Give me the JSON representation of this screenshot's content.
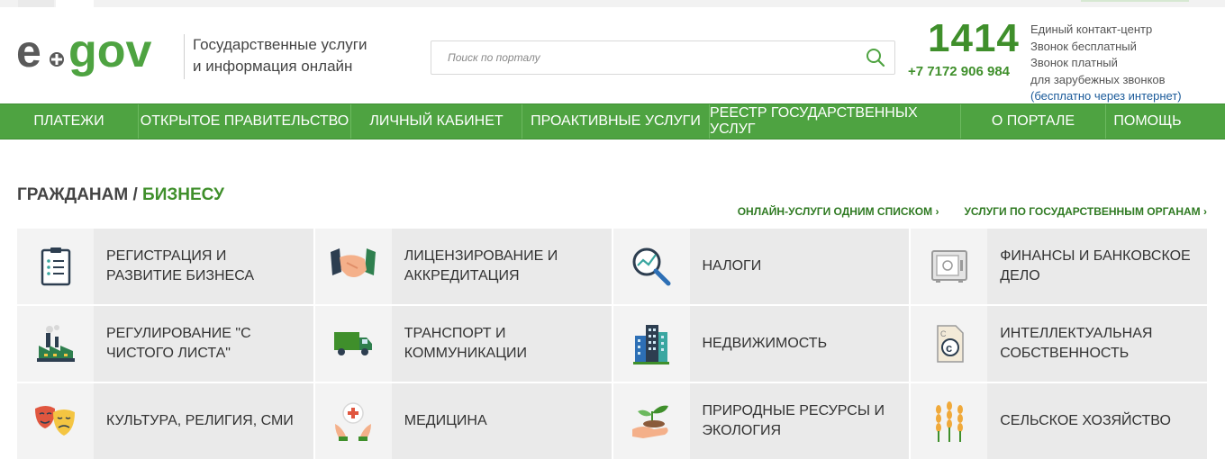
{
  "header": {
    "logo_text": "e.gov",
    "tagline_line1": "Государственные услуги",
    "tagline_line2": "и информация онлайн",
    "search_placeholder": "Поиск по порталу",
    "contact_number": "1414",
    "contact_phone": "+7 7172 906 984",
    "contact_line1": "Единый контакт-центр",
    "contact_line2": "Звонок бесплатный",
    "contact_line3": "Звонок платный",
    "contact_line4": "для зарубежных звонков",
    "contact_line5": "(бесплатно через интернет)"
  },
  "nav": [
    {
      "label": "ПЛАТЕЖИ",
      "width": 154
    },
    {
      "label": "ОТКРЫТОЕ ПРАВИТЕЛЬСТВО",
      "width": 236
    },
    {
      "label": "ЛИЧНЫЙ КАБИНЕТ",
      "width": 190
    },
    {
      "label": "ПРОАКТИВНЫЕ УСЛУГИ",
      "width": 208
    },
    {
      "label": "РЕЕСТР ГОСУДАРСТВЕННЫХ УСЛУГ",
      "width": 279
    },
    {
      "label": "О ПОРТАЛЕ",
      "width": 161
    },
    {
      "label": "ПОМОЩЬ",
      "width": 92
    }
  ],
  "section": {
    "title_part1": "ГРАЖДАНАМ /",
    "title_part2": "БИЗНЕСУ",
    "link1": "ОНЛАЙН-УСЛУГИ ОДНИМ СПИСКОМ ›",
    "link2": "УСЛУГИ ПО ГОСУДАРСТВЕННЫМ ОРГАНАМ ›"
  },
  "tiles": [
    {
      "label": "РЕГИСТРАЦИЯ И РАЗВИТИЕ БИЗНЕСА",
      "icon": "clipboard-icon"
    },
    {
      "label": "ЛИЦЕНЗИРОВАНИЕ И АККРЕДИТАЦИЯ",
      "icon": "handshake-icon"
    },
    {
      "label": "НАЛОГИ",
      "icon": "magnifier-chart-icon"
    },
    {
      "label": "ФИНАНСЫ И БАНКОВСКОЕ ДЕЛО",
      "icon": "safe-icon"
    },
    {
      "label": "РЕГУЛИРОВАНИЕ \"С ЧИСТОГО ЛИСТА\"",
      "icon": "factory-icon"
    },
    {
      "label": "ТРАНСПОРТ И КОММУНИКАЦИИ",
      "icon": "truck-icon"
    },
    {
      "label": "НЕДВИЖИМОСТЬ",
      "icon": "buildings-icon"
    },
    {
      "label": "ИНТЕЛЛЕКТУАЛЬНАЯ СОБСТВЕННОСТЬ",
      "icon": "copyright-icon"
    },
    {
      "label": "КУЛЬТУРА, РЕЛИГИЯ, СМИ",
      "icon": "theater-masks-icon"
    },
    {
      "label": "МЕДИЦИНА",
      "icon": "medical-hands-icon"
    },
    {
      "label": "ПРИРОДНЫЕ РЕСУРСЫ И ЭКОЛОГИЯ",
      "icon": "sprout-hand-icon"
    },
    {
      "label": "СЕЛЬСКОЕ ХОЗЯЙСТВО",
      "icon": "wheat-icon"
    }
  ],
  "colors": {
    "brand_green": "#4ea341",
    "dark_green": "#3f8f2b",
    "logo_gray": "#5a5a5a",
    "link_blue": "#1a5a99"
  }
}
